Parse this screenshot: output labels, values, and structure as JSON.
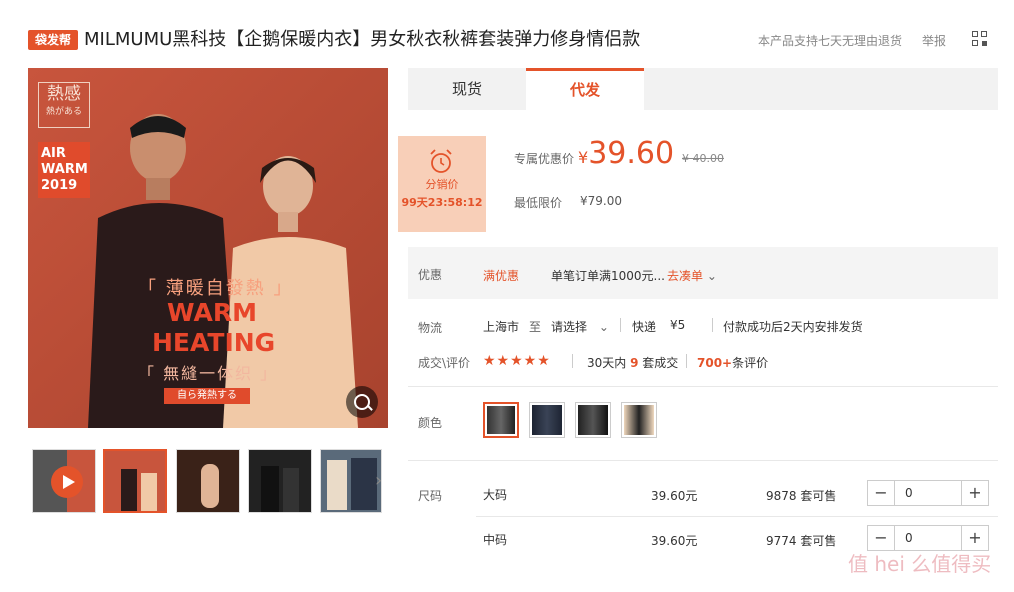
{
  "header": {
    "badge": "袋发帮",
    "title": "MILMUMU黑科技【企鹅保暖内衣】男女秋衣秋裤套装弹力修身情侣款",
    "return_policy": "本产品支持七天无理由退货",
    "report": "举报",
    "qr_icon": "qr-code-icon"
  },
  "gallery": {
    "tag_top": "熱感",
    "tag_top_small": "熱がある",
    "tag_air": "AIR WARM 2019",
    "sub1": "「 薄暖自發熱 」",
    "headline1": "WARM",
    "headline2": "HEATING",
    "sub2": "「 無縫一体织 」",
    "sub3": "自ら発熱する",
    "zoom_icon": "zoom-icon",
    "next_icon": "chevron-right-icon"
  },
  "tabs": [
    {
      "label": "现货"
    },
    {
      "label": "代发"
    }
  ],
  "timer": {
    "label": "分销价",
    "countdown": "99天23:58:12",
    "icon": "alarm-clock-icon"
  },
  "pricing": {
    "exclusive_label": "专属优惠价",
    "currency": "¥",
    "price": "39.60",
    "original": "¥ 40.00",
    "min_label": "最低限价",
    "min_price": "¥79.00"
  },
  "promo": {
    "label": "优惠",
    "tag": "满优惠",
    "desc": "单笔订单满1000元...",
    "link": "去凑单"
  },
  "shipping": {
    "label": "物流",
    "from": "上海市",
    "to_word": "至",
    "to": "请选择",
    "method": "快递",
    "fee": "¥5",
    "note": "付款成功后2天内安排发货"
  },
  "reviews": {
    "label": "成交\\评价",
    "stars": "★★★★★",
    "sold_prefix": "30天内",
    "sold_count": "9",
    "sold_suffix": "套成交",
    "review_count": "700+",
    "review_suffix": "条评价"
  },
  "color": {
    "label": "颜色"
  },
  "sizes": {
    "label": "尺码",
    "rows": [
      {
        "name": "大码",
        "price": "39.60元",
        "stock": "9878 套可售",
        "qty": "0"
      },
      {
        "name": "中码",
        "price": "39.60元",
        "stock": "9774 套可售",
        "qty": "0"
      }
    ]
  },
  "watermark": "值 hei 么值得买"
}
